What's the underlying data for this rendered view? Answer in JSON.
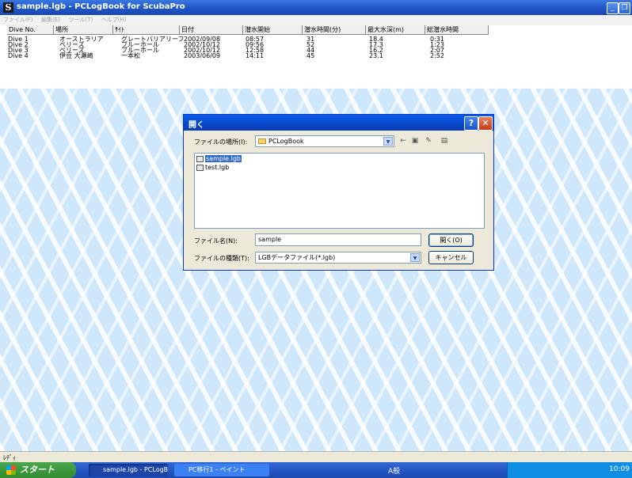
{
  "window": {
    "title": "sample.lgb - PCLogBook for ScubaPro",
    "app_icon": "S",
    "min_label": "_",
    "restore_label": "❐"
  },
  "menubar": {
    "items": [
      {
        "label": "ファイル(F)"
      },
      {
        "label": "編集(E)"
      },
      {
        "label": "ツール(T)"
      },
      {
        "label": "ヘルプ(H)"
      }
    ]
  },
  "table": {
    "headers": [
      "Dive No.",
      "場所",
      "ｻｲﾄ",
      "日付",
      "潜水開始",
      "潜水時間(分)",
      "最大水深(m)",
      "総潜水時間"
    ],
    "rows": [
      [
        "Dive 1",
        "オーストラリア",
        "グレートバリアリーフ",
        "2002/09/08",
        "08:57",
        "31",
        "18.4",
        "0:31"
      ],
      [
        "Dive 2",
        "ベリーズ",
        "ブルーホール",
        "2002/10/12",
        "09:56",
        "52",
        "17.3",
        "1:23"
      ],
      [
        "Dive 3",
        "ベリーズ",
        "ブルーホール",
        "2002/10/12",
        "12:58",
        "44",
        "16.2",
        "2:07"
      ],
      [
        "Dive 4",
        "伊豆 大瀬崎",
        "一本松",
        "2003/06/09",
        "14:11",
        "45",
        "23.1",
        "2:52"
      ]
    ]
  },
  "dialog": {
    "title": "開く",
    "help_label": "?",
    "close_label": "✕",
    "look_in_label": "ファイルの場所(I):",
    "look_in_value": "PCLogBook",
    "files": [
      {
        "name": "sample.lgb",
        "selected": true
      },
      {
        "name": "test.lgb",
        "selected": false
      }
    ],
    "filename_label": "ファイル名(N):",
    "filename_value": "sample",
    "filetype_label": "ファイルの種類(T):",
    "filetype_value": "LGBデータファイル(*.lgb)",
    "open_button": "開く(O)",
    "cancel_button": "キャンセル"
  },
  "statusbar": {
    "text": "ﾚﾃﾞｨ"
  },
  "taskbar": {
    "start_label": "スタート",
    "tasks": [
      {
        "label": "sample.lgb - PCLogB..."
      },
      {
        "label": "PC移行1 - ペイント"
      }
    ],
    "ime_label": "A般",
    "clock": "10:09"
  }
}
